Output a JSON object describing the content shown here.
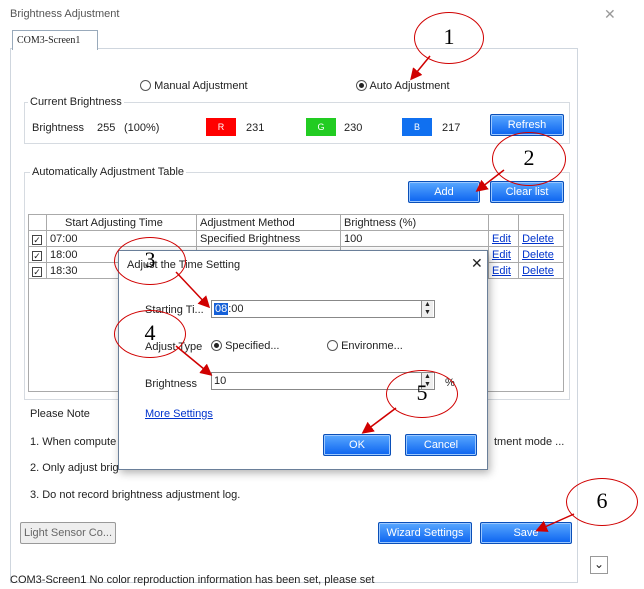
{
  "window": {
    "title": "Brightness Adjustment",
    "tab": "COM3-Screen1"
  },
  "mode": {
    "manual": "Manual Adjustment",
    "auto": "Auto Adjustment"
  },
  "current": {
    "group": "Current Brightness",
    "label": "Brightness",
    "value": "255",
    "percent": "(100%)",
    "r_label": "R",
    "r_value": "231",
    "g_label": "G",
    "g_value": "230",
    "b_label": "B",
    "b_value": "217",
    "refresh": "Refresh"
  },
  "table_group": {
    "label": "Automatically Adjustment Table",
    "add": "Add",
    "clear": "Clear list"
  },
  "table": {
    "headers": [
      "Start Adjusting Time",
      "Adjustment Method",
      "Brightness (%)"
    ],
    "rows": [
      {
        "time": "07:00",
        "method": "Specified Brightness",
        "value": "100",
        "edit": "Edit",
        "delete": "Delete"
      },
      {
        "time": "18:00",
        "edit": "Edit",
        "delete": "Delete"
      },
      {
        "time": "18:30",
        "edit": "Edit",
        "delete": "Delete"
      }
    ]
  },
  "note": {
    "title": "Please Note",
    "line1": "1. When compute",
    "line1_tail": "tment mode ...",
    "line2": "2. Only adjust brig",
    "line3": "3. Do not record brightness adjustment log."
  },
  "footer": {
    "sensor": "Light Sensor Co...",
    "wizard": "Wizard Settings",
    "save": "Save",
    "status": "COM3-Screen1 No color reproduction information has been set, please set"
  },
  "dialog": {
    "title": "Adjust the Time Setting",
    "start_label": "Starting Ti...",
    "start_sel": "08",
    "start_rest": ":00",
    "adjust_label": "Adjust Type",
    "specified": "Specified...",
    "environment": "Environme...",
    "brightness_label": "Brightness",
    "brightness_value": "10",
    "percent": "%",
    "more": "More Settings",
    "ok": "OK",
    "cancel": "Cancel"
  },
  "annotations": [
    "1",
    "2",
    "3",
    "4",
    "5",
    "6"
  ]
}
